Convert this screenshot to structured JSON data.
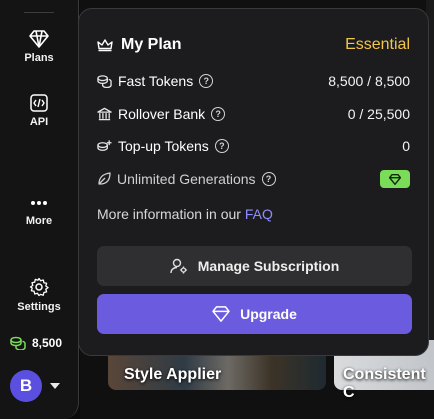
{
  "sidebar": {
    "items": [
      {
        "label": "Plans",
        "icon": "diamond-icon"
      },
      {
        "label": "API",
        "icon": "api-icon"
      },
      {
        "label": "More",
        "icon": "more-dots-icon"
      },
      {
        "label": "Settings",
        "icon": "gear-icon"
      }
    ],
    "credits": "8,500",
    "avatar_initial": "B"
  },
  "panel": {
    "title": "My Plan",
    "plan_name": "Essential",
    "rows": [
      {
        "label": "Fast Tokens",
        "value": "8,500 / 8,500",
        "icon": "coins-icon"
      },
      {
        "label": "Rollover Bank",
        "value": "0 / 25,500",
        "icon": "bank-icon"
      },
      {
        "label": "Top-up Tokens",
        "value": "0",
        "icon": "topup-coins-icon"
      },
      {
        "label": "Unlimited Generations",
        "icon": "leaf-icon"
      }
    ],
    "more_info_text": "More information in our",
    "faq_link": "FAQ",
    "manage_button": "Manage Subscription",
    "upgrade_button": "Upgrade"
  },
  "background": {
    "card_a_title": "Style Applier",
    "card_b_title": "Consistent C"
  },
  "colors": {
    "accent": "#6b5bdf",
    "plan": "#f3c54a",
    "badge": "#7bdc5a",
    "link": "#8f8cff"
  }
}
